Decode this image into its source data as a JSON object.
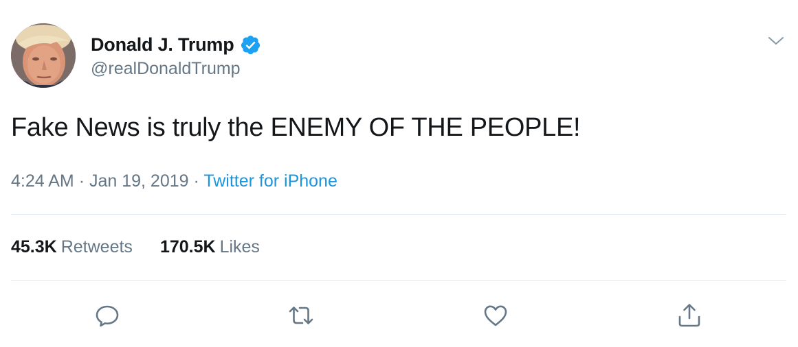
{
  "user": {
    "display_name": "Donald J. Trump",
    "handle": "@realDonaldTrump",
    "verified": true,
    "avatar_icon": "profile-photo"
  },
  "tweet": {
    "text": "Fake News is truly the ENEMY OF THE PEOPLE!",
    "time": "4:24 AM",
    "separator": "·",
    "date": "Jan 19, 2019",
    "source": "Twitter for iPhone"
  },
  "stats": {
    "retweets_count": "45.3K",
    "retweets_label": "Retweets",
    "likes_count": "170.5K",
    "likes_label": "Likes"
  },
  "actions": {
    "reply_icon": "speech-bubble-icon",
    "retweet_icon": "retweet-arrows-icon",
    "like_icon": "heart-icon",
    "share_icon": "share-upload-icon",
    "menu_icon": "chevron-down-icon"
  },
  "colors": {
    "text_primary": "#14171a",
    "text_secondary": "#657786",
    "link": "#1b95e0",
    "verified_badge": "#1da1f2",
    "divider": "#e1e8ed"
  }
}
